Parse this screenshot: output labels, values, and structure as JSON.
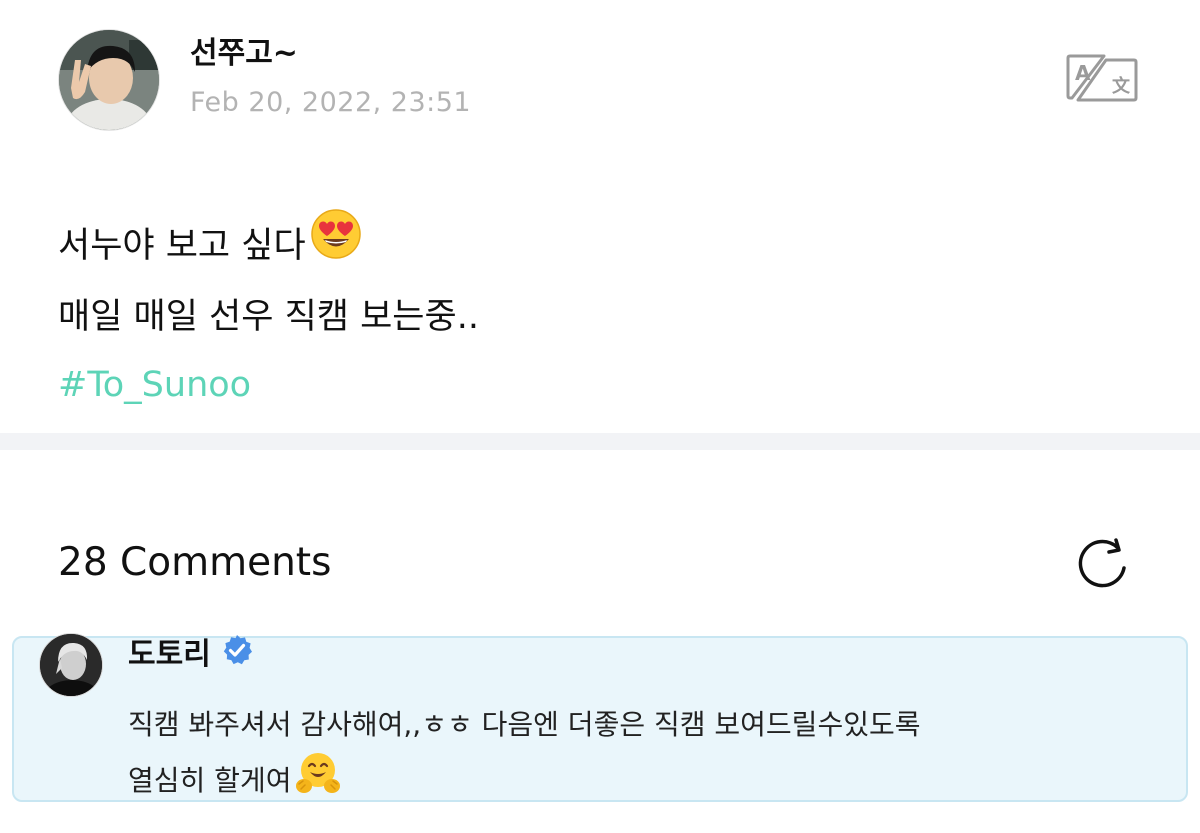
{
  "post": {
    "author": "선쭈고~",
    "timestamp": "Feb 20, 2022, 23:51",
    "body_lines": [
      "서누야 보고 싶다",
      "매일 매일 선우 직캠 보는중.."
    ],
    "line1_emoji": "heart-eyes-emoji",
    "hashtag": "#To_Sunoo",
    "translate_icon": "translate-icon"
  },
  "comments": {
    "header": "28 Comments",
    "refresh_icon": "refresh-icon",
    "items": [
      {
        "author": "도토리",
        "verified": true,
        "text_lines": [
          "직캠 봐주셔서 감사해여,,ㅎㅎ 다음엔 더좋은 직캠 보여드릴수있도록",
          "열심히 할게여"
        ],
        "end_emoji": "hugging-face-emoji"
      }
    ]
  },
  "colors": {
    "hashtag": "#5dd4b7",
    "timestamp": "#b3b3b3",
    "comment_bg": "#eaf6fb",
    "comment_border": "#c8e6f2",
    "verified_badge": "#4a8fe7",
    "divider": "#f2f3f6"
  }
}
